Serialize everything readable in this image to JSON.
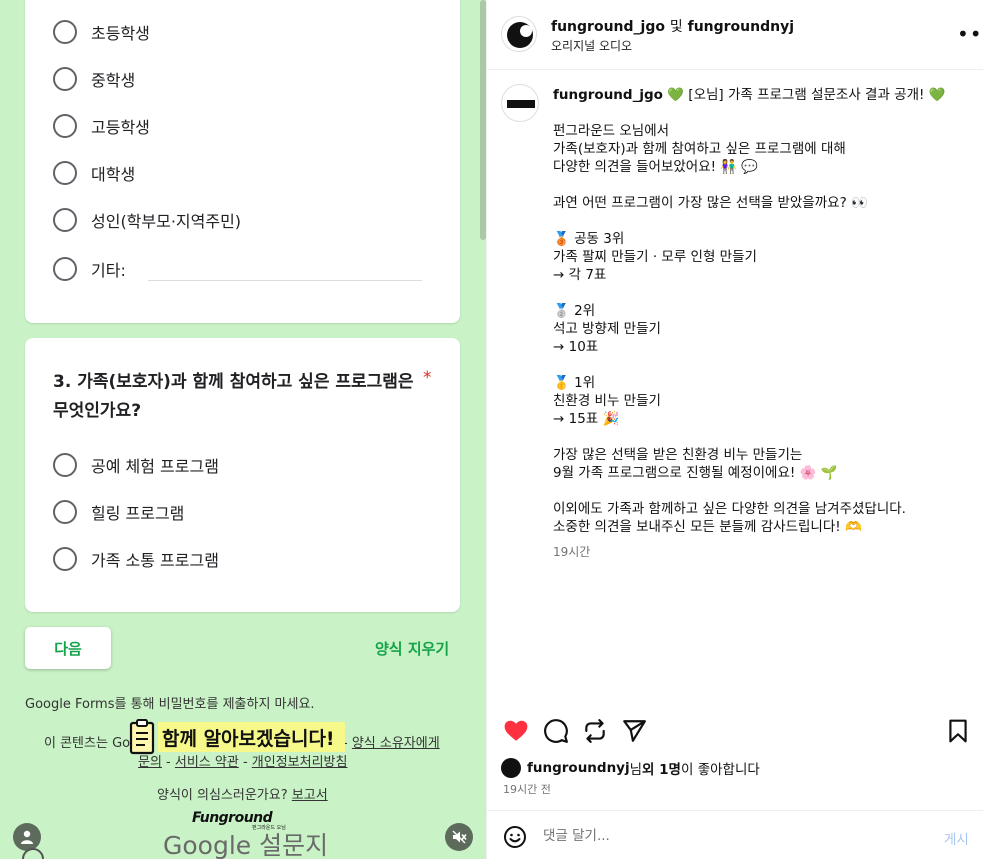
{
  "form": {
    "q2_options": [
      "초등학생",
      "중학생",
      "고등학생",
      "대학생",
      "성인(학부모·지역주민)",
      "기타:"
    ],
    "q3_title": "3. 가족(보호자)과 함께 참여하고 싶은 프로그램은 무엇인가요?",
    "q3_required": "*",
    "q3_options": [
      "공예 체험 프로그램",
      "힐링 프로그램",
      "가족 소통 프로그램"
    ],
    "next_label": "다음",
    "clear_label": "양식 지우기",
    "footer_password": "Google Forms를 통해 비밀번호를 제출하지 마세요.",
    "footer_content_prefix": "이 콘텐츠는 Go",
    "footer_owner_link": "양식 소유자에게",
    "footer_inquiry": "문의",
    "footer_terms": "서비스 약관",
    "footer_privacy": "개인정보처리방침",
    "footer_suspicious": "양식이 의심스러운가요?",
    "footer_report": "보고서",
    "overlay_caption": "함께 알아보겠습니다!",
    "brand_logo": "Funground",
    "brand_sub": "펀그라운드 오님",
    "google_forms": "Google 설문지"
  },
  "instagram": {
    "header_names": "funground_jgo",
    "header_and": "및",
    "header_second": "fungroundnyj",
    "header_audio": "오리지널 오디오",
    "post_user": "funground_jgo",
    "caption_title": " 💚 [오님] 가족 프로그램 설문조사 결과 공개! 💚",
    "caption_body": "펀그라운드 오님에서\n가족(보호자)과 함께 참여하고 싶은 프로그램에 대해\n다양한 의견을 들어보았어요! 👫 💬\n\n과연 어떤 프로그램이 가장 많은 선택을 받았을까요? 👀\n\n🥉 공동 3위\n가족 팔찌 만들기 · 모루 인형 만들기\n→ 각 7표\n\n🥈 2위\n석고 방향제 만들기\n→ 10표\n\n🥇 1위\n친환경 비누 만들기\n→ 15표 🎉\n\n가장 많은 선택을 받은 친환경 비누 만들기는\n9월 가족 프로그램으로 진행될 예정이에요! 🌸 🌱\n\n이외에도 가족과 함께하고 싶은 다양한 의견을 남겨주셨답니다.\n소중한 의견을 보내주신 모든 분들께 감사드립니다! 🫶",
    "post_time": "19시간",
    "likes_user": "fungroundnyj",
    "likes_mid": "님 ",
    "likes_others": "외 1명",
    "likes_suffix": "이 좋아합니다",
    "ago": "19시간 전",
    "comment_placeholder": "댓글 달기...",
    "post_button": "게시",
    "colors": {
      "like_red": "#ff3040",
      "link_green": "#15a34a",
      "form_bg": "#c9f3c6"
    }
  }
}
